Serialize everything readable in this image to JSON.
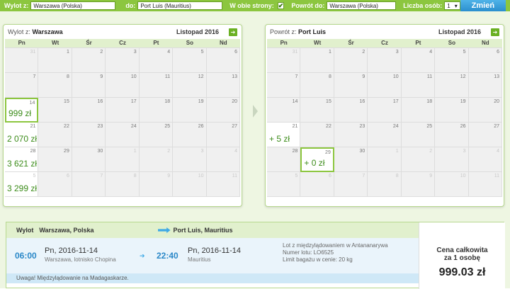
{
  "search": {
    "from_label": "Wylot z:",
    "from_value": "Warszawa (Polska)",
    "to_label": "do:",
    "to_value": "Port Luis (Mauritius)",
    "roundtrip_label": "W obie strony:",
    "roundtrip_checked": "✔",
    "return_label": "Powrót do:",
    "return_value": "Warszawa (Polska)",
    "persons_label": "Liczba osób:",
    "persons_value": "1",
    "submit_label": "Zmień"
  },
  "days_of_week": [
    "Pn",
    "Wt",
    "Śr",
    "Cz",
    "Pt",
    "So",
    "Nd"
  ],
  "outbound": {
    "title_prefix": "Wylot z:",
    "title_city": "Warszawa",
    "month": "Listopad 2016",
    "cells": [
      {
        "d": "31",
        "m": 1
      },
      {
        "d": "1"
      },
      {
        "d": "2"
      },
      {
        "d": "3"
      },
      {
        "d": "4"
      },
      {
        "d": "5"
      },
      {
        "d": "6"
      },
      {
        "d": "7"
      },
      {
        "d": "8"
      },
      {
        "d": "9"
      },
      {
        "d": "10"
      },
      {
        "d": "11"
      },
      {
        "d": "12"
      },
      {
        "d": "13"
      },
      {
        "d": "14",
        "p": "999 zł",
        "s": 1
      },
      {
        "d": "15"
      },
      {
        "d": "16"
      },
      {
        "d": "17"
      },
      {
        "d": "18"
      },
      {
        "d": "19"
      },
      {
        "d": "20"
      },
      {
        "d": "21",
        "p": "2 070 zł"
      },
      {
        "d": "22"
      },
      {
        "d": "23"
      },
      {
        "d": "24"
      },
      {
        "d": "25"
      },
      {
        "d": "26"
      },
      {
        "d": "27"
      },
      {
        "d": "28",
        "p": "3 621 zł"
      },
      {
        "d": "29"
      },
      {
        "d": "30"
      },
      {
        "d": "1",
        "m": 1
      },
      {
        "d": "2",
        "m": 1
      },
      {
        "d": "3",
        "m": 1
      },
      {
        "d": "4",
        "m": 1
      },
      {
        "d": "5",
        "m": 1,
        "p": "3 299 zł"
      },
      {
        "d": "6",
        "m": 1
      },
      {
        "d": "7",
        "m": 1
      },
      {
        "d": "8",
        "m": 1
      },
      {
        "d": "9",
        "m": 1
      },
      {
        "d": "10",
        "m": 1
      },
      {
        "d": "11",
        "m": 1
      }
    ]
  },
  "return": {
    "title_prefix": "Powrót z:",
    "title_city": "Port Luis",
    "month": "Listopad 2016",
    "cells": [
      {
        "d": "31",
        "m": 1
      },
      {
        "d": "1"
      },
      {
        "d": "2"
      },
      {
        "d": "3"
      },
      {
        "d": "4"
      },
      {
        "d": "5"
      },
      {
        "d": "6"
      },
      {
        "d": "7"
      },
      {
        "d": "8"
      },
      {
        "d": "9"
      },
      {
        "d": "10"
      },
      {
        "d": "11"
      },
      {
        "d": "12"
      },
      {
        "d": "13"
      },
      {
        "d": "14"
      },
      {
        "d": "15"
      },
      {
        "d": "16"
      },
      {
        "d": "17"
      },
      {
        "d": "18"
      },
      {
        "d": "19"
      },
      {
        "d": "20"
      },
      {
        "d": "21",
        "p": "+ 5 zł"
      },
      {
        "d": "22"
      },
      {
        "d": "23"
      },
      {
        "d": "24"
      },
      {
        "d": "25"
      },
      {
        "d": "26"
      },
      {
        "d": "27"
      },
      {
        "d": "28"
      },
      {
        "d": "29",
        "p": "+ 0 zł",
        "s": 1
      },
      {
        "d": "30"
      },
      {
        "d": "1",
        "m": 1
      },
      {
        "d": "2",
        "m": 1
      },
      {
        "d": "3",
        "m": 1
      },
      {
        "d": "4",
        "m": 1
      },
      {
        "d": "5",
        "m": 1
      },
      {
        "d": "6",
        "m": 1
      },
      {
        "d": "7",
        "m": 1
      },
      {
        "d": "8",
        "m": 1
      },
      {
        "d": "9",
        "m": 1
      },
      {
        "d": "10",
        "m": 1
      },
      {
        "d": "11",
        "m": 1
      }
    ]
  },
  "flight": {
    "head_label": "Wylot",
    "from": "Warszawa, Polska",
    "to": "Port Luis, Mauritius",
    "dep_time": "06:00",
    "dep_date": "Pn, 2016-11-14",
    "dep_place": "Warszawa, lotnisko Chopina",
    "arr_time": "22:40",
    "arr_date": "Pn, 2016-11-14",
    "arr_place": "Mauritius",
    "info1": "Lot z międzylądowaniem w Antananarywa",
    "info2": "Numer lotu: LO6525",
    "info3": "Limit bagażu w cenie: 20 kg",
    "warning": "Uwaga! Międzylądowanie na Madagaskarze.",
    "price_label1": "Cena całkowita",
    "price_label2": "za 1 osobę",
    "price_value": "999.03 zł"
  }
}
